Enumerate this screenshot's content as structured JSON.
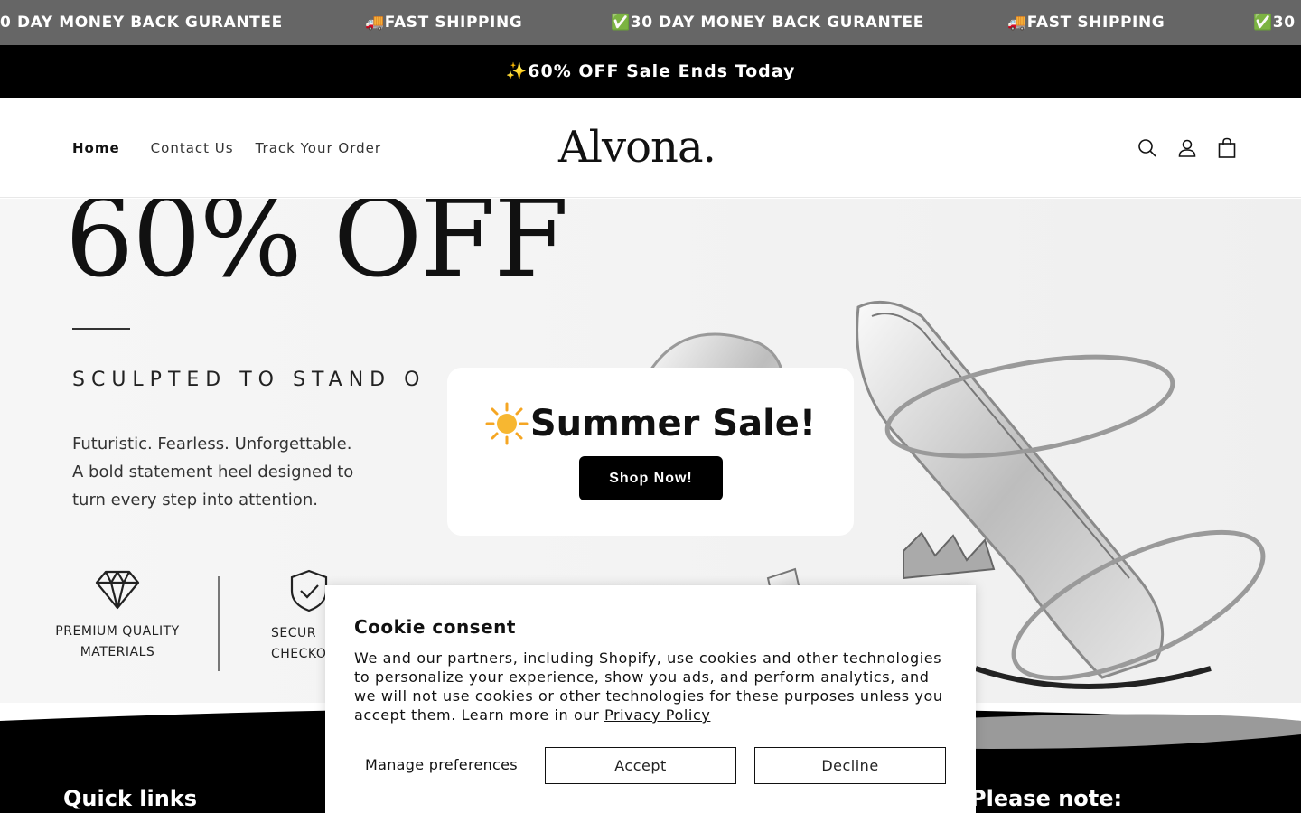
{
  "marquee": {
    "items": [
      "0 DAY MONEY BACK GURANTEE",
      "🚚FAST SHIPPING",
      "✅30 DAY MONEY BACK GURANTEE",
      "🚚FAST SHIPPING",
      "✅30"
    ]
  },
  "announcement": "✨60% OFF Sale Ends Today",
  "header": {
    "nav": [
      "Home",
      "Contact Us",
      "Track Your Order"
    ],
    "logo": "Alvona."
  },
  "hero": {
    "headline": "60% OFF",
    "tagline": "SCULPTED TO STAND O",
    "copy": [
      "Futuristic. Fearless. Unforgettable.",
      "A bold statement heel designed to",
      "turn every step into attention."
    ],
    "features": [
      {
        "icon": "diamond-icon",
        "line1": "PREMIUM QUALITY",
        "line2": "MATERIALS"
      },
      {
        "icon": "shield-check-icon",
        "line1": "SECUR",
        "line2": "CHECKO"
      }
    ]
  },
  "popup": {
    "title": "Summer Sale!",
    "button": "Shop Now!"
  },
  "footer": {
    "quick_links": "Quick links",
    "please_note": "Please note:"
  },
  "cookie": {
    "title": "Cookie consent",
    "text": "We and our partners, including Shopify, use cookies and other technologies to personalize your experience, show you ads, and perform analytics, and we will not use cookies or other technologies for these purposes unless you accept them. Learn more in our ",
    "privacy_link": "Privacy Policy",
    "manage": "Manage preferences",
    "accept": "Accept",
    "decline": "Decline"
  }
}
